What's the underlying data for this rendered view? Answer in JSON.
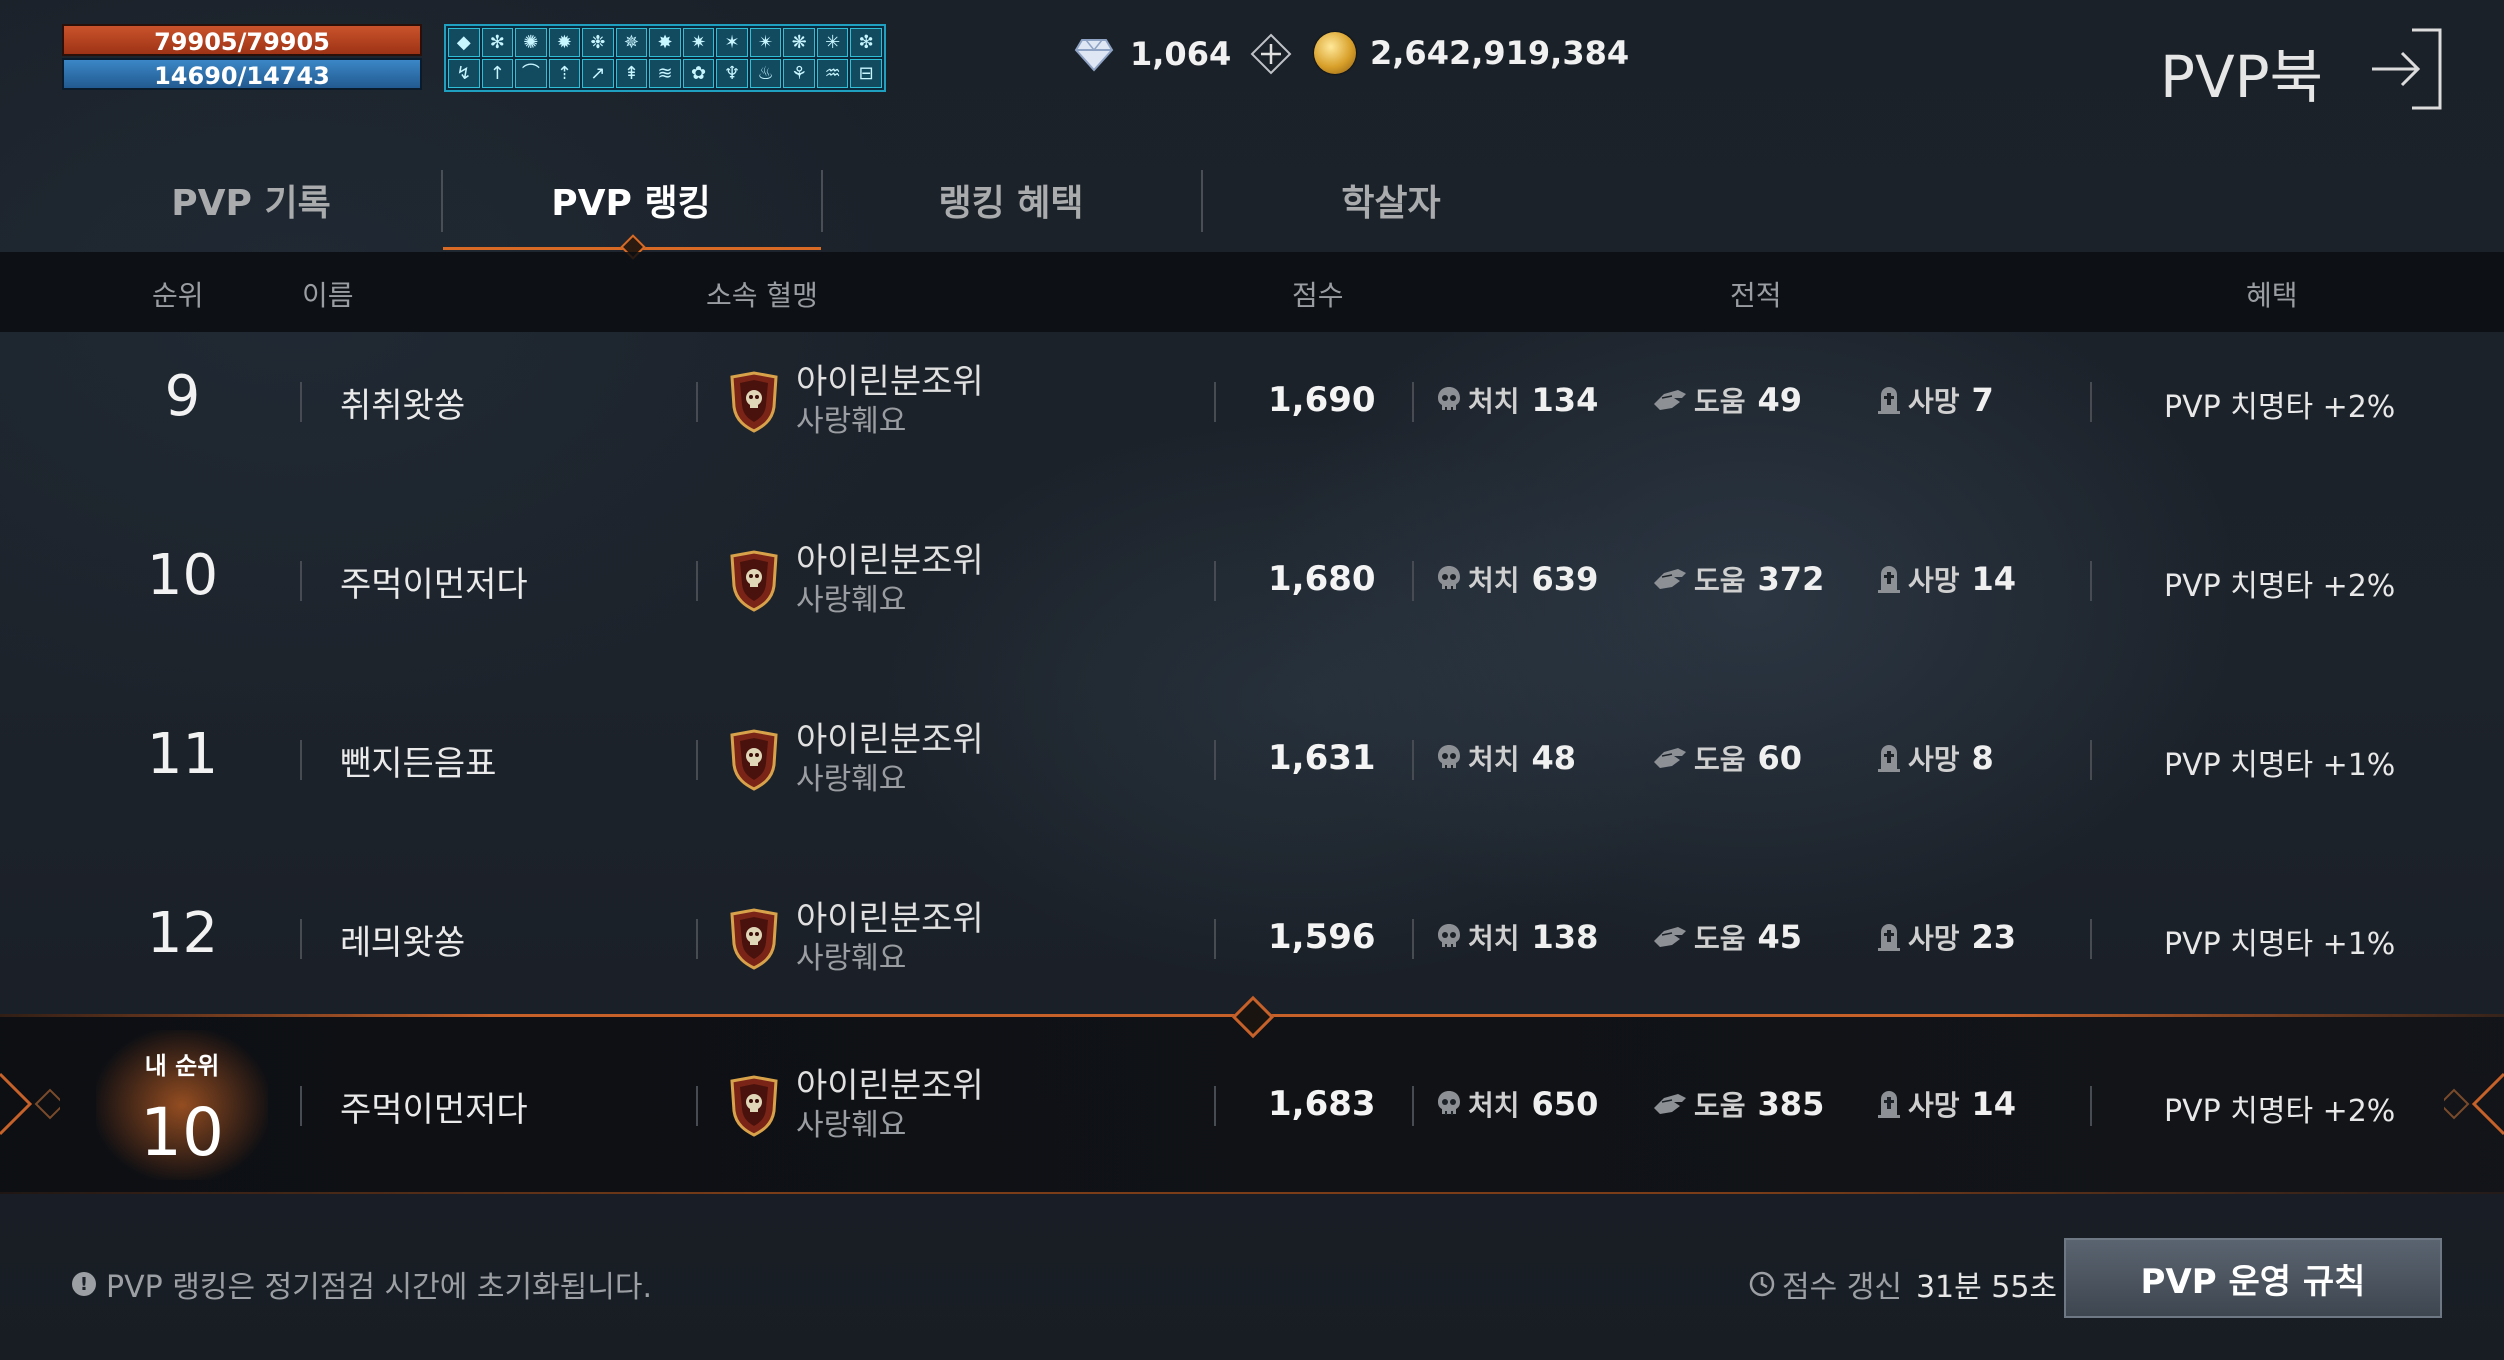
{
  "player": {
    "hp": "79905/79905",
    "mp": "14690/14743",
    "buff_icons": [
      "◆",
      "✻",
      "✺",
      "✹",
      "❉",
      "✵",
      "✸",
      "✷",
      "✶",
      "✴",
      "❋",
      "✳",
      "❇",
      "↯",
      "↑",
      "⌒",
      "⇡",
      "↗",
      "⇞",
      "≋",
      "✿",
      "♆",
      "♨",
      "⚘",
      "♒",
      "⊟"
    ]
  },
  "currency": {
    "diamonds": "1,064",
    "gold": "2,642,919,384"
  },
  "page_title": "PVP북",
  "tabs": [
    {
      "label": "PVP 기록",
      "active": false
    },
    {
      "label": "PVP 랭킹",
      "active": true
    },
    {
      "label": "랭킹 혜택",
      "active": false
    },
    {
      "label": "학살자",
      "active": false
    }
  ],
  "columns": {
    "rank": "순위",
    "name": "이름",
    "guild": "소속 혈맹",
    "score": "점수",
    "record": "전적",
    "benefit": "혜택"
  },
  "stat_labels": {
    "kill": "처치",
    "assist": "도움",
    "death": "사망"
  },
  "rows": [
    {
      "rank": "9",
      "name": "취취왓쏭",
      "guild": "아이린분조위",
      "guild_sub": "사랑훼요",
      "score": "1,690",
      "kill": "134",
      "assist": "49",
      "death": "7",
      "benefit": "PVP 치명타 +2%"
    },
    {
      "rank": "10",
      "name": "주먹이먼저다",
      "guild": "아이린분조위",
      "guild_sub": "사랑훼요",
      "score": "1,680",
      "kill": "639",
      "assist": "372",
      "death": "14",
      "benefit": "PVP 치명타 +2%"
    },
    {
      "rank": "11",
      "name": "뺀지든음표",
      "guild": "아이린분조위",
      "guild_sub": "사랑훼요",
      "score": "1,631",
      "kill": "48",
      "assist": "60",
      "death": "8",
      "benefit": "PVP 치명타 +1%"
    },
    {
      "rank": "12",
      "name": "레믜왓쏭",
      "guild": "아이린분조위",
      "guild_sub": "사랑훼요",
      "score": "1,596",
      "kill": "138",
      "assist": "45",
      "death": "23",
      "benefit": "PVP 치명타 +1%"
    }
  ],
  "my_rank": {
    "label": "내 순위",
    "rank": "10",
    "name": "주먹이먼저다",
    "guild": "아이린분조위",
    "guild_sub": "사랑훼요",
    "score": "1,683",
    "kill": "650",
    "assist": "385",
    "death": "14",
    "benefit": "PVP 치명타 +2%"
  },
  "footer": {
    "notice": "PVP 랭킹은 정기점검 시간에 초기화됩니다.",
    "timer_label": "점수 갱신",
    "timer_value": "31분 55초",
    "rules_button": "PVP 운영 규칙"
  },
  "colors": {
    "accent": "#d96a25",
    "hp": "#c9532b",
    "mp": "#3b87c7"
  }
}
